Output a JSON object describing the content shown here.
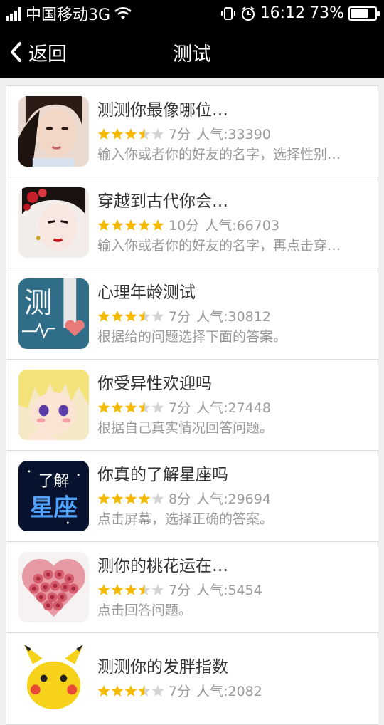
{
  "status_bar": {
    "carrier": "中国移动3G",
    "time": "16:12",
    "battery": "73%",
    "battery_level": 0.73,
    "icons": [
      "signal-icon",
      "wifi-icon",
      "phone-vibrate-icon",
      "alarm-icon",
      "battery-icon"
    ]
  },
  "nav": {
    "back_label": "返回",
    "title": "测试"
  },
  "colors": {
    "star_on": "#f5b900",
    "star_off": "#d4d4d4",
    "nav_bg": "#000000",
    "text_muted": "#9a9a9a"
  },
  "items": [
    {
      "title": "测测你最像哪位…",
      "rating": 3.5,
      "score": "7分",
      "popularity": "人气:33390",
      "desc": "输入你或者你的好友的名字，选择性别…",
      "thumb": "portrait-woman-1"
    },
    {
      "title": "穿越到古代你会…",
      "rating": 5,
      "score": "10分",
      "popularity": "人气:66703",
      "desc": "输入你或者你的好友的名字，再点击穿…",
      "thumb": "portrait-ancient-woman"
    },
    {
      "title": "心理年龄测试",
      "rating": 3.5,
      "score": "7分",
      "popularity": "人气:30812",
      "desc": "根据给的问题选择下面的答案。",
      "thumb_text": "测",
      "thumb": "test-heart-icon"
    },
    {
      "title": "你受异性欢迎吗",
      "rating": 3.5,
      "score": "7分",
      "popularity": "人气:27448",
      "desc": "根据自己真实情况回答问题。",
      "thumb": "anime-boy"
    },
    {
      "title": "你真的了解星座吗",
      "rating": 4,
      "score": "8分",
      "popularity": "人气:29694",
      "desc": "点击屏幕，选择正确的答案。",
      "thumb_text_top": "了解",
      "thumb_text_bottom": "星座",
      "thumb": "constellation-icon"
    },
    {
      "title": "测你的桃花运在…",
      "rating": 3.5,
      "score": "7分",
      "popularity": "人气:5454",
      "desc": "点击回答问题。",
      "thumb": "rose-heart"
    },
    {
      "title": "测测你的发胖指数",
      "rating": 3.5,
      "score": "7分",
      "popularity": "人气:2082",
      "desc": "",
      "thumb": "pikachu"
    }
  ]
}
